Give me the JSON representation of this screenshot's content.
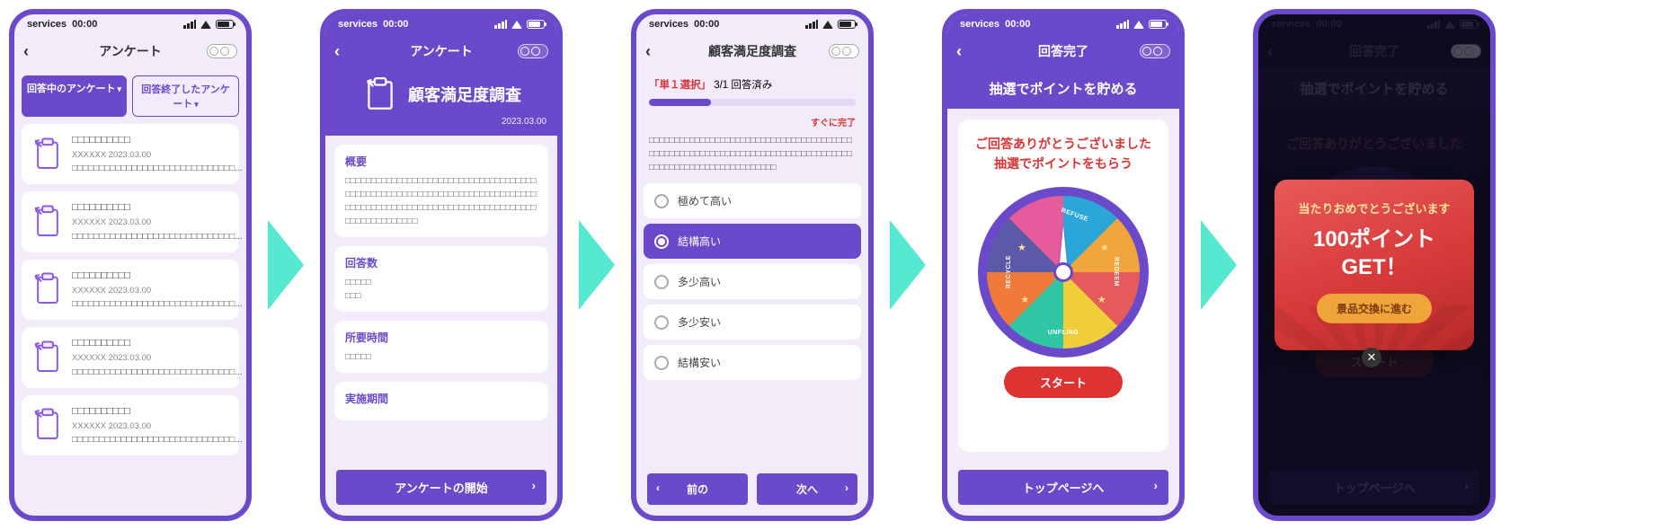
{
  "status": {
    "carrier": "services",
    "time": "00:00"
  },
  "screen1": {
    "title": "アンケート",
    "tab_active": "回答中のアンケート",
    "tab_inactive": "回答終了したアンケート",
    "items": [
      {
        "title": "□□□□□□□□□□",
        "meta": "XXXXXX  2023.03.00",
        "body": "□□□□□□□□□□□□□□□□□□□□□□□□□□□□□□..."
      },
      {
        "title": "□□□□□□□□□□",
        "meta": "XXXXXX  2023.03.00",
        "body": "□□□□□□□□□□□□□□□□□□□□□□□□□□□□□□..."
      },
      {
        "title": "□□□□□□□□□□",
        "meta": "XXXXXX  2023.03.00",
        "body": "□□□□□□□□□□□□□□□□□□□□□□□□□□□□□□..."
      },
      {
        "title": "□□□□□□□□□□",
        "meta": "XXXXXX  2023.03.00",
        "body": "□□□□□□□□□□□□□□□□□□□□□□□□□□□□□□..."
      },
      {
        "title": "□□□□□□□□□□",
        "meta": "XXXXXX  2023.03.00",
        "body": "□□□□□□□□□□□□□□□□□□□□□□□□□□□□□□..."
      }
    ]
  },
  "screen2": {
    "nav": "アンケート",
    "hero_title": "顧客満足度調査",
    "date": "2023.03.00",
    "overview_label": "概要",
    "overview_body": "□□□□□□□□□□□□□□□□□□□□□□□□□□□□□□□□□□□□□□□□□□□□□□□□□□□□□□□□□□□□□□□□□□□□□□□□□□□□□□□□□□□□□□□□□□□□□□□□□□□□□□□□□□□□□□□□□□□□□□□□□□□□□",
    "count_label": "回答数",
    "count_body": "□□□□□\n□□□",
    "duration_label": "所要時間",
    "duration_body": "□□□□□",
    "period_label": "実施期間",
    "start_btn": "アンケートの開始"
  },
  "screen3": {
    "nav": "顧客満足度調査",
    "tag_type": "「単１選択」",
    "tag_progress": "3/1 回答済み",
    "soon": "すぐに完了",
    "question": "□□□□□□□□□□□□□□□□□□□□□□□□□□□□□□□□□□□□□□□□□□□□□□□□□□□□□□□□□□□□□□□□□□□□□□□□□□□□□□□□□□□□□□□□□□□□□□□□□□□□□□□□□",
    "options": [
      "極めて高い",
      "結構高い",
      "多少高い",
      "多少安い",
      "結構安い"
    ],
    "selected_index": 1,
    "prev": "前の",
    "next": "次へ"
  },
  "screen4": {
    "nav": "回答完了",
    "banner": "抽選でポイントを貯める",
    "thanks_line1": "ご回答ありがとうございました",
    "thanks_line2": "抽選でポイントをもらう",
    "wheel_labels": [
      "REFUSE",
      "REDEEM",
      "UNFLING",
      "RECYCLE"
    ],
    "start": "スタート",
    "footer": "トップページへ"
  },
  "screen5": {
    "nav": "回答完了",
    "banner": "抽選でポイントを貯める",
    "thanks_line1": "ご回答ありがとうございました",
    "start": "スタート",
    "footer": "トップページへ",
    "modal_title": "当たりおめでとうございます",
    "modal_points": "100ポイント",
    "modal_get": "GET！",
    "modal_btn": "景品交換に進む"
  }
}
